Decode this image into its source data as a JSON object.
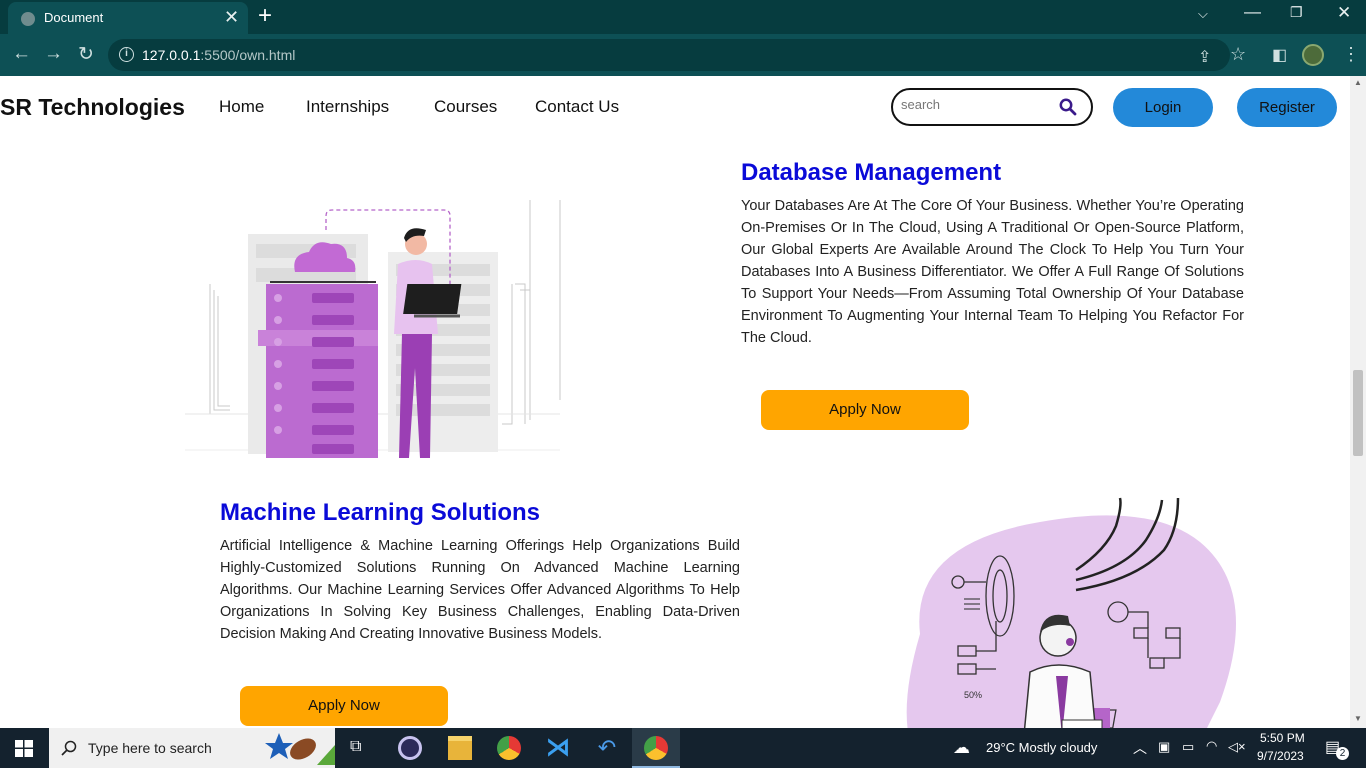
{
  "browser": {
    "tab_title": "Document",
    "url_host": "127.0.0.1",
    "url_rest": ":5500/own.html"
  },
  "site": {
    "brand": "SR Technologies",
    "nav": [
      "Home",
      "Internships",
      "Courses",
      "Contact Us"
    ],
    "search_placeholder": "search",
    "login_label": "Login",
    "register_label": "Register"
  },
  "sections": [
    {
      "title": "Database Management",
      "body": "Your Databases Are At The Core Of Your Business. Whether You’re Operating On-Premises Or In The Cloud, Using A Traditional Or Open-Source Platform, Our Global Experts Are Available Around The Clock To Help You Turn Your Databases Into A Business Differentiator. We Offer A Full Range Of Solutions To Support Your Needs—From Assuming Total Ownership Of Your Database Environment To Augmenting Your Internal Team To Helping You Refactor For The Cloud.",
      "button": "Apply Now"
    },
    {
      "title": "Machine Learning Solutions",
      "body": "Artificial Intelligence & Machine Learning Offerings Help Organizations Build Highly-Customized Solutions Running On Advanced Machine Learning Algorithms. Our Machine Learning Services Offer Advanced Algorithms To Help Organizations In Solving Key Business Challenges, Enabling Data-Driven Decision Making And Creating Innovative Business Models.",
      "button": "Apply Now",
      "illustration_text": "50%"
    }
  ],
  "taskbar": {
    "search_placeholder": "Type here to search",
    "weather": "29°C  Mostly cloudy",
    "time": "5:50 PM",
    "date": "9/7/2023",
    "notifications": "2"
  },
  "colors": {
    "chrome_dark": "#063c3f",
    "chrome_tab": "#0d5055",
    "heading_blue": "#0a0ad8",
    "button_blue": "#2389d9",
    "apply_orange": "#ffa500",
    "illustration_purple": "#b565c9"
  }
}
